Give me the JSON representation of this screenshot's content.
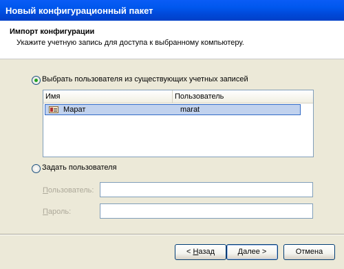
{
  "window": {
    "title": "Новый конфигурационный пакет"
  },
  "header": {
    "title": "Импорт конфигурации",
    "subtitle": "Укажите учетную запись для доступа к выбранному компьютеру."
  },
  "options": {
    "existing": {
      "label": "Выбрать пользователя из существующих учетных записей",
      "checked": true
    },
    "custom": {
      "label": "Задать пользователя",
      "checked": false
    }
  },
  "list": {
    "columns": [
      "Имя",
      "Пользователь"
    ],
    "rows": [
      {
        "name": "Марат",
        "user": "marat",
        "icon": "user-card-icon",
        "selected": true
      }
    ]
  },
  "fields": {
    "user": {
      "label_pre": "",
      "label_key": "П",
      "label_post": "ользователь:",
      "value": ""
    },
    "password": {
      "label_pre": "",
      "label_key": "П",
      "label_post": "ароль:",
      "value": ""
    }
  },
  "buttons": {
    "back": {
      "pre": "< ",
      "key": "Н",
      "post": "азад"
    },
    "next": {
      "pre": "",
      "key": "Д",
      "post": "алее >"
    },
    "cancel": {
      "label": "Отмена"
    }
  }
}
